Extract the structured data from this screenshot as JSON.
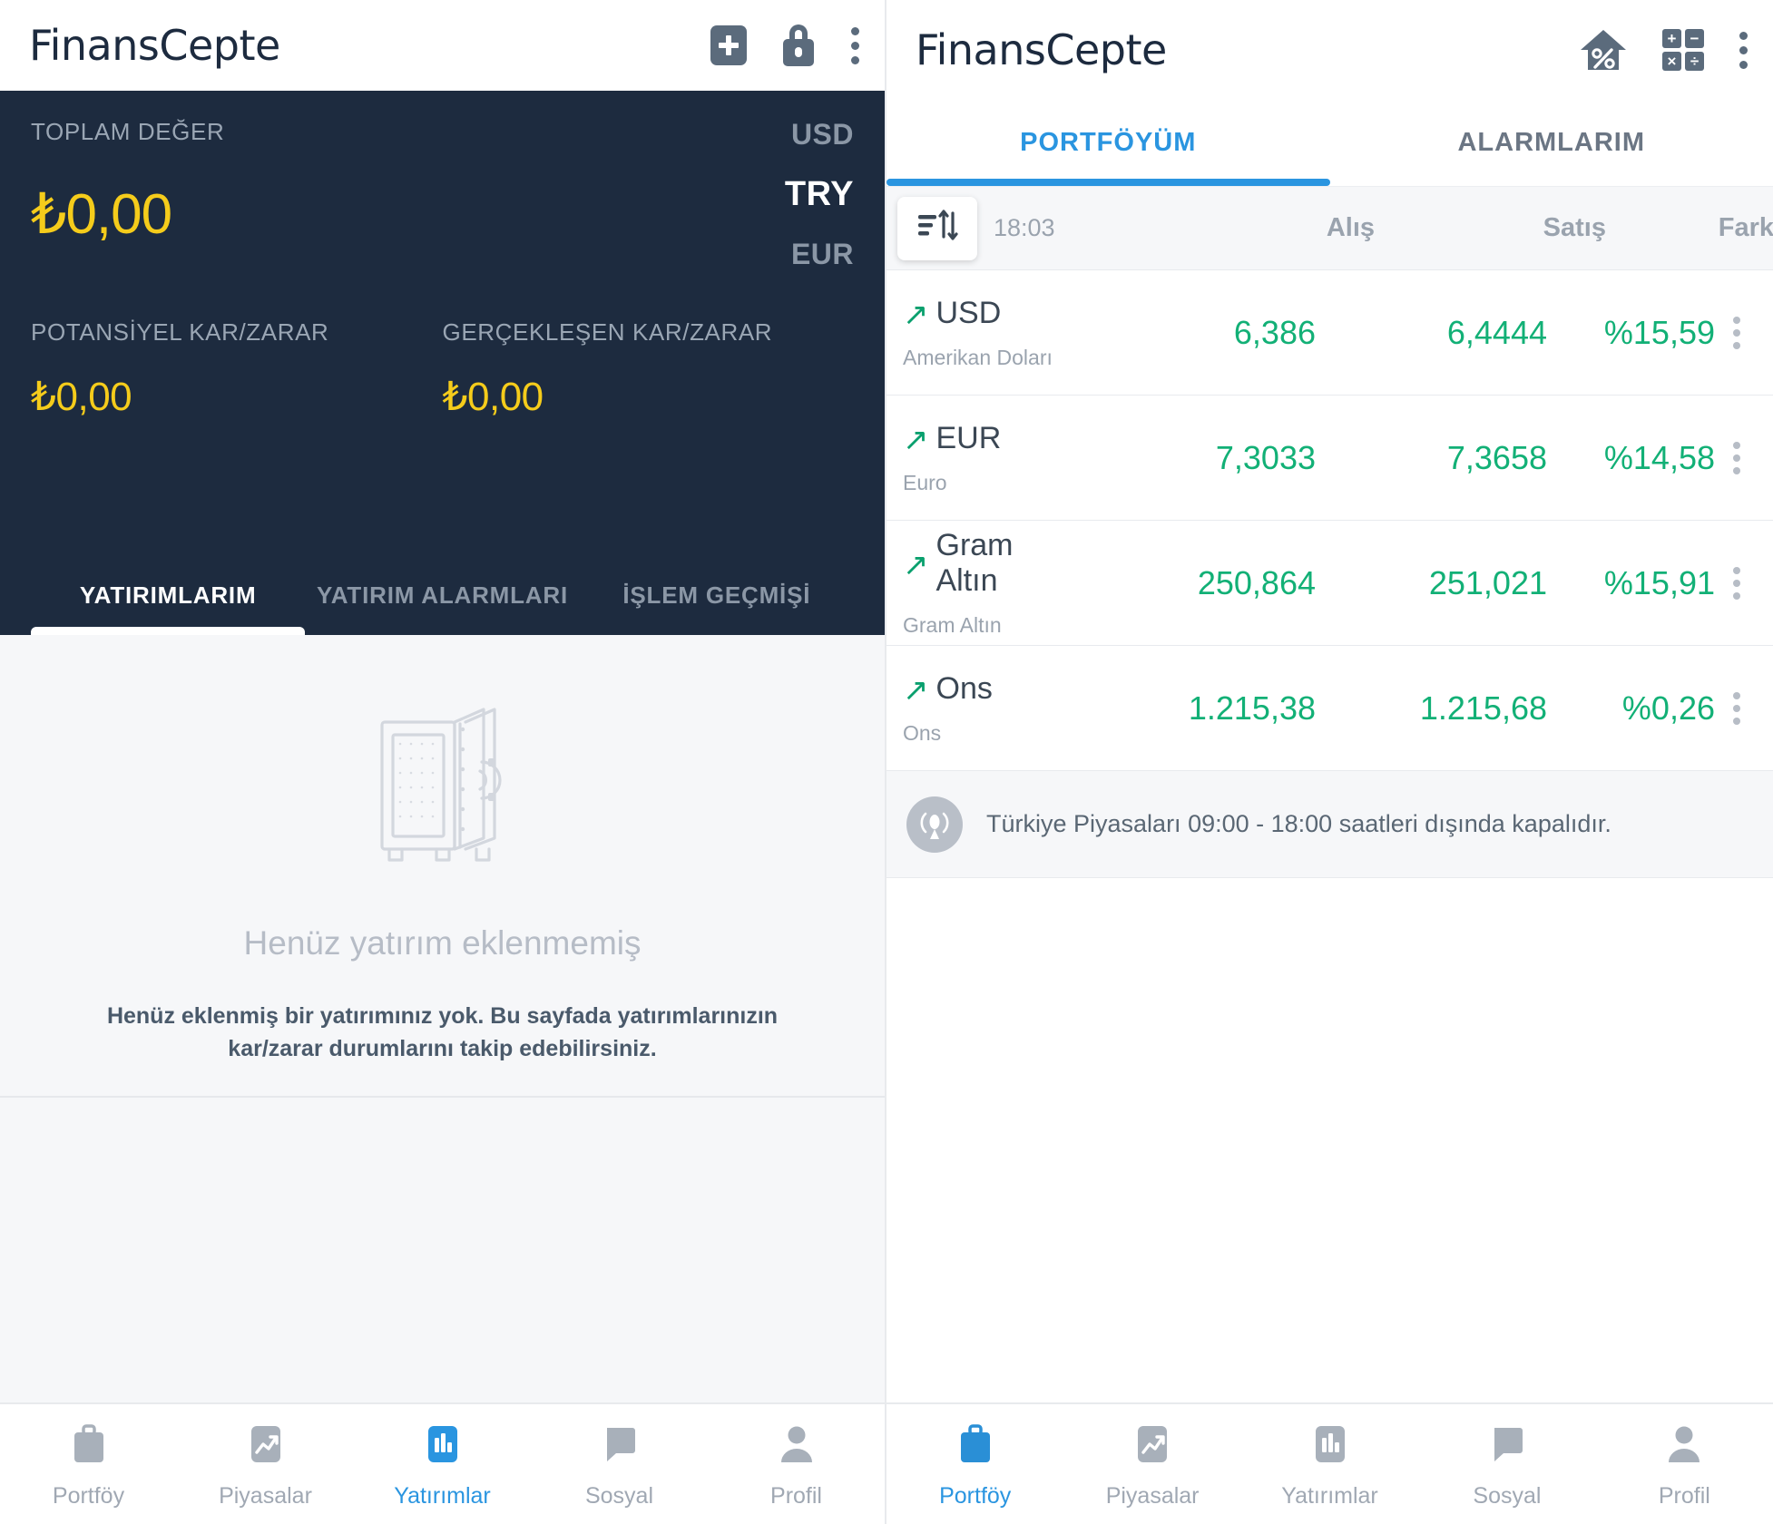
{
  "brand": "FinansCepte",
  "left": {
    "appbar": {
      "title": "FinansCepte",
      "actions": [
        {
          "name": "add-icon",
          "label": "+"
        },
        {
          "name": "lock-icon",
          "label": "lock"
        },
        {
          "name": "overflow-menu-icon",
          "label": "more"
        }
      ]
    },
    "summary": {
      "total_label": "TOPLAM DEĞER",
      "total_value": "₺0,00",
      "currencies": [
        {
          "code": "USD",
          "active": false
        },
        {
          "code": "TRY",
          "active": true
        },
        {
          "code": "EUR",
          "active": false
        }
      ],
      "potential_label": "POTANSİYEL KAR/ZARAR",
      "potential_value": "₺0,00",
      "realized_label": "GERÇEKLEŞEN KAR/ZARAR",
      "realized_value": "₺0,00"
    },
    "tabs": [
      {
        "label": "YATIRIMLARIM",
        "active": true
      },
      {
        "label": "YATIRIM ALARMLARI",
        "active": false
      },
      {
        "label": "İŞLEM GEÇMİŞİ",
        "active": false
      }
    ],
    "empty": {
      "icon": "safe-icon",
      "title": "Henüz yatırım eklenmemiş",
      "subtitle": "Henüz eklenmiş bir yatırımınız yok. Bu sayfada yatırımlarınızın kar/zarar durumlarını takip edebilirsiniz."
    },
    "bottom_nav": [
      {
        "label": "Portföy",
        "icon": "briefcase-icon",
        "active": false
      },
      {
        "label": "Piyasalar",
        "icon": "trending-up-icon",
        "active": false
      },
      {
        "label": "Yatırımlar",
        "icon": "bar-chart-icon",
        "active": true
      },
      {
        "label": "Sosyal",
        "icon": "chat-bubble-icon",
        "active": false
      },
      {
        "label": "Profil",
        "icon": "person-icon",
        "active": false
      }
    ]
  },
  "right": {
    "appbar": {
      "title": "FinansCepte",
      "actions": [
        {
          "name": "house-percent-icon",
          "label": "rates"
        },
        {
          "name": "calculator-icon",
          "label": "calculator"
        },
        {
          "name": "overflow-menu-icon",
          "label": "more"
        }
      ]
    },
    "tabs": [
      {
        "label": "PORTFÖYÜM",
        "active": true
      },
      {
        "label": "ALARMLARIM",
        "active": false
      }
    ],
    "table": {
      "sort_icon": "sort-icon",
      "time": "18:03",
      "columns": [
        "Alış",
        "Satış",
        "Fark"
      ],
      "rows": [
        {
          "symbol": "USD",
          "name": "Amerikan Doları",
          "buy": "6,386",
          "sell": "6,4444",
          "diff": "%15,59",
          "trend": "up"
        },
        {
          "symbol": "EUR",
          "name": "Euro",
          "buy": "7,3033",
          "sell": "7,3658",
          "diff": "%14,58",
          "trend": "up"
        },
        {
          "symbol": "Gram Altın",
          "name": "Gram Altın",
          "buy": "250,864",
          "sell": "251,021",
          "diff": "%15,91",
          "trend": "up"
        },
        {
          "symbol": "Ons",
          "name": "Ons",
          "buy": "1.215,38",
          "sell": "1.215,68",
          "diff": "%0,26",
          "trend": "up"
        }
      ]
    },
    "notice": {
      "icon": "broadcast-icon",
      "text": "Türkiye Piyasaları 09:00 - 18:00 saatleri dışında kapalıdır."
    },
    "bottom_nav": [
      {
        "label": "Portföy",
        "icon": "briefcase-icon",
        "active": true
      },
      {
        "label": "Piyasalar",
        "icon": "trending-up-icon",
        "active": false
      },
      {
        "label": "Yatırımlar",
        "icon": "bar-chart-icon",
        "active": false
      },
      {
        "label": "Sosyal",
        "icon": "chat-bubble-icon",
        "active": false
      },
      {
        "label": "Profil",
        "icon": "person-icon",
        "active": false
      }
    ]
  },
  "colors": {
    "dark_panel": "#1d2b3f",
    "accent_yellow": "#f5cc1b",
    "accent_blue": "#2a95e0",
    "positive_green": "#12b076",
    "muted_gray": "#9aa3ae"
  }
}
